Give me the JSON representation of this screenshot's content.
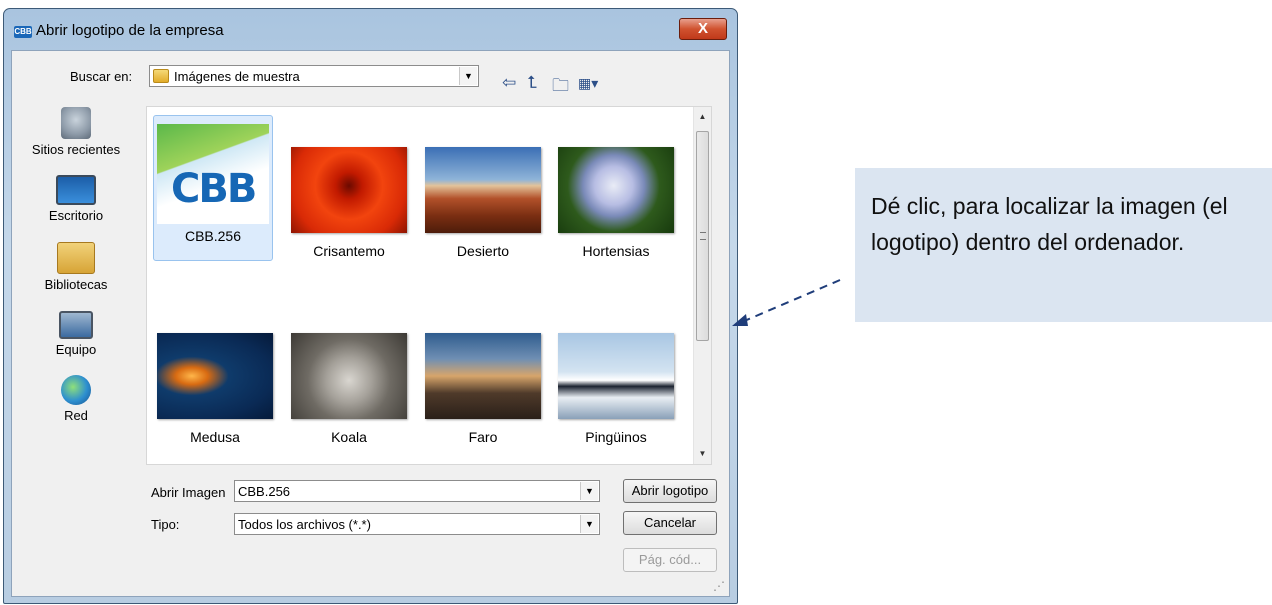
{
  "window": {
    "title": "Abrir logotipo de la empresa",
    "app_icon_text": "CBB",
    "close_label": "X"
  },
  "lookin": {
    "label": "Buscar en:",
    "value": "Imágenes de muestra"
  },
  "toolbar_icons": [
    "back-arrow-icon",
    "up-folder-icon",
    "new-folder-icon",
    "view-menu-icon"
  ],
  "places": [
    {
      "label": "Sitios recientes",
      "icon": "recent-places-icon"
    },
    {
      "label": "Escritorio",
      "icon": "desktop-icon"
    },
    {
      "label": "Bibliotecas",
      "icon": "libraries-icon"
    },
    {
      "label": "Equipo",
      "icon": "computer-icon"
    },
    {
      "label": "Red",
      "icon": "network-icon"
    }
  ],
  "files": [
    {
      "name": "CBB.256",
      "selected": true,
      "logo_text": "CBB"
    },
    {
      "name": "Crisantemo"
    },
    {
      "name": "Desierto"
    },
    {
      "name": "Hortensias"
    },
    {
      "name": "Medusa"
    },
    {
      "name": "Koala"
    },
    {
      "name": "Faro"
    },
    {
      "name": "Pingüinos"
    }
  ],
  "filename": {
    "label": "Abrir Imagen",
    "value": "CBB.256"
  },
  "filetype": {
    "label": "Tipo:",
    "value": "Todos los archivos (*.*)"
  },
  "buttons": {
    "open": "Abrir logotipo",
    "cancel": "Cancelar",
    "codepage": "Pág. cód..."
  },
  "callout": {
    "text": "Dé clic, para localizar la imagen (el logotipo) dentro del ordenador."
  },
  "colors": {
    "callout_bg": "#dbe5f1",
    "selection": "#dcebfc",
    "arrow": "#1f3d7a"
  }
}
